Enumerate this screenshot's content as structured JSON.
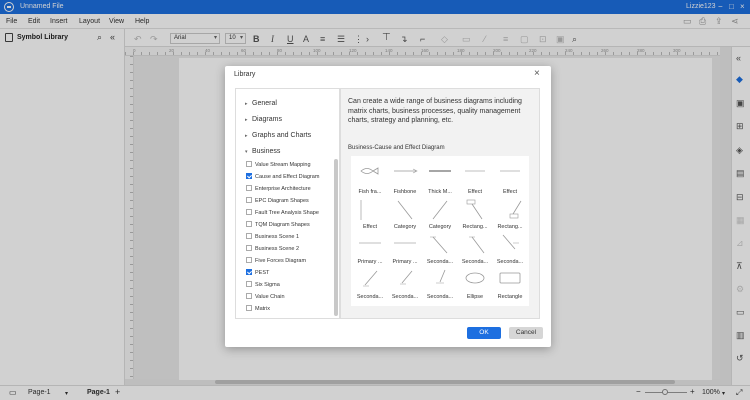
{
  "window": {
    "file_name": "Unnamed File",
    "user": "Lizzie123"
  },
  "menu": [
    "File",
    "Edit",
    "Insert",
    "Layout",
    "View",
    "Help"
  ],
  "sidebar": {
    "title": "Symbol Library"
  },
  "toolbar": {
    "font": "Arial",
    "font_size": "10"
  },
  "ruler": [
    "0",
    "20",
    "40",
    "60",
    "80",
    "100",
    "120",
    "140",
    "160",
    "180",
    "200",
    "220",
    "240",
    "260",
    "280",
    "300"
  ],
  "dialog": {
    "title": "Library",
    "categories": [
      "General",
      "Diagrams",
      "Graphs and Charts",
      "Business"
    ],
    "items": [
      {
        "label": "Value Stream Mapping",
        "checked": false
      },
      {
        "label": "Cause and Effect Diagram",
        "checked": true
      },
      {
        "label": "Enterprise Architecture",
        "checked": false
      },
      {
        "label": "EPC Diagram Shapes",
        "checked": false
      },
      {
        "label": "Fault Tree Analysis Shape",
        "checked": false
      },
      {
        "label": "TQM Diagram Shapes",
        "checked": false
      },
      {
        "label": "Business Scene 1",
        "checked": false
      },
      {
        "label": "Business Scene 2",
        "checked": false
      },
      {
        "label": "Five Forces Diagram",
        "checked": false
      },
      {
        "label": "PEST",
        "checked": true
      },
      {
        "label": "Six Sigma",
        "checked": false
      },
      {
        "label": "Value Chain",
        "checked": false
      },
      {
        "label": "Matrix",
        "checked": false
      }
    ],
    "description": "Can create a wide range of business diagrams including matrix charts, business processes, quality management charts, strategy and planning, etc.",
    "section_title": "Business-Cause and Effect Diagram",
    "shapes": [
      "Fish fra...",
      "Fishbone",
      "Thick M...",
      "Effect",
      "Effect",
      "Effect",
      "Category",
      "Category",
      "Rectang...",
      "Rectang...",
      "Primary ...",
      "Primary ...",
      "Seconda...",
      "Seconda...",
      "Seconda...",
      "Seconda...",
      "Seconda...",
      "Seconda...",
      "Ellipse",
      "Rectangle"
    ],
    "ok_label": "OK",
    "cancel_label": "Cancel"
  },
  "status": {
    "page_tab": "Page-1",
    "active_page": "Page-1",
    "zoom": "100%"
  }
}
